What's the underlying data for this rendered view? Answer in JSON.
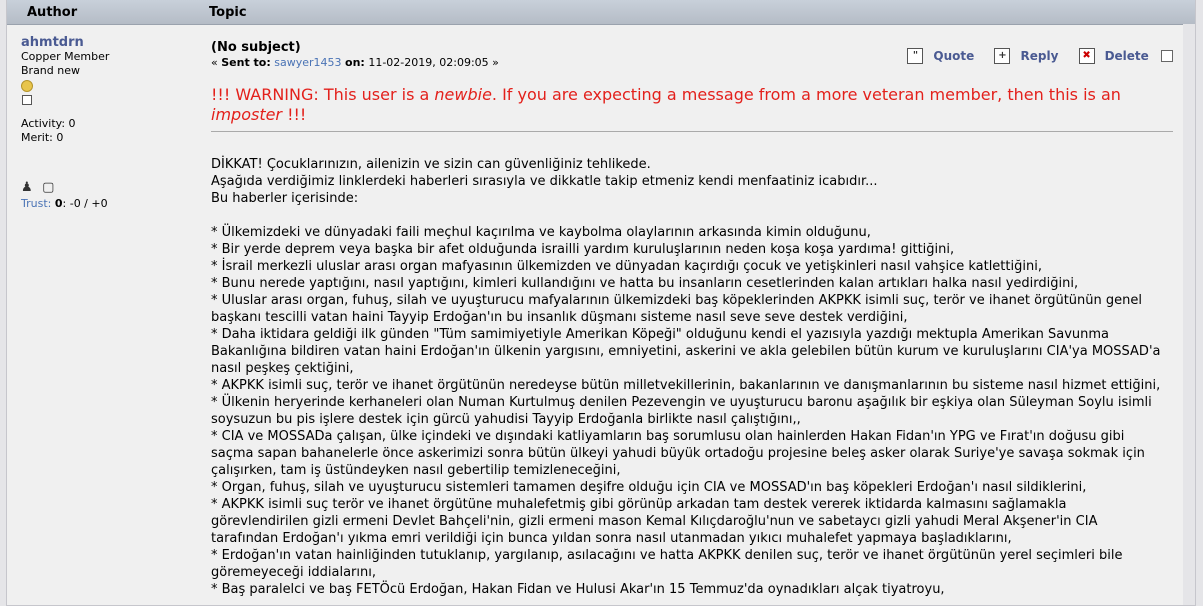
{
  "header": {
    "author": "Author",
    "topic": "Topic"
  },
  "user": {
    "name": "ahmtdrn",
    "rank": "Copper Member",
    "status": "Brand new",
    "activity": "Activity: 0",
    "merit": "Merit: 0",
    "trust_label": "Trust:",
    "trust_score": "0",
    "trust_rest": ": -0 / +0"
  },
  "post": {
    "subject": "(No subject)",
    "sent_prefix": "«",
    "sent_label": "Sent to:",
    "sent_to": "sawyer1453",
    "on_label": "on:",
    "date": "11-02-2019, 02:09:05",
    "sent_suffix": "»",
    "actions": {
      "quote": "Quote",
      "reply": "Reply",
      "delete": "Delete"
    },
    "warning": {
      "a": "!!! WARNING: This user is a ",
      "b": "newbie",
      "c": ". If you are expecting a message from a more veteran member, then this is an ",
      "d": "imposter",
      "e": " !!!"
    },
    "lines": [
      "DİKKAT! Çocuklarınızın, ailenizin ve sizin can güvenliğiniz tehlikede.",
      "Aşağıda verdiğimiz linklerdeki haberleri sırasıyla ve dikkatle takip etmeniz kendi menfaatiniz icabıdır...",
      "Bu haberler içerisinde:",
      "",
      "* Ülkemizdeki ve dünyadaki faili meçhul kaçırılma ve kaybolma olaylarının arkasında kimin olduğunu,",
      "* Bir yerde deprem veya başka bir afet olduğunda israilli yardım kuruluşlarının neden koşa koşa yardıma! gittiğini,",
      "* İsrail merkezli uluslar arası organ mafyasının ülkemizden ve dünyadan kaçırdığı çocuk ve yetişkinleri nasıl vahşice katlettiğini,",
      "* Bunu nerede yaptığını, nasıl yaptığını, kimleri kullandığını ve hatta bu insanların cesetlerinden kalan artıkları halka nasıl yedirdiğini,",
      "* Uluslar arası organ, fuhuş, silah ve uyuşturucu mafyalarının ülkemizdeki baş köpeklerinden AKPKK isimli suç, terör ve ihanet örgütünün genel başkanı tescilli vatan haini Tayyip Erdoğan'ın bu insanlık düşmanı sisteme nasıl seve seve destek verdiğini,",
      "* Daha iktidara geldiği ilk günden \"Tüm samimiyetiyle Amerikan Köpeği\" olduğunu kendi el yazısıyla yazdığı mektupla Amerikan Savunma Bakanlığına bildiren vatan haini Erdoğan'ın ülkenin yargısını, emniyetini, askerini ve akla gelebilen bütün kurum ve kuruluşlarını CIA'ya MOSSAD'a nasıl peşkeş çektiğini,",
      "* AKPKK isimli suç, terör ve ihanet örgütünün neredeyse bütün milletvekillerinin, bakanlarının ve danışmanlarının bu sisteme nasıl hizmet ettiğini,",
      "* Ülkenin heryerinde kerhaneleri olan Numan Kurtulmuş denilen Pezevengin ve uyuşturucu baronu aşağılık bir eşkiya olan Süleyman Soylu isimli soysuzun bu pis işlere destek için gürcü yahudisi Tayyip Erdoğanla birlikte nasıl çalıştığını,,",
      "* CIA ve MOSSADa çalışan, ülke içindeki ve dışındaki katliyamların baş sorumlusu olan hainlerden Hakan Fidan'ın YPG ve Fırat'ın doğusu gibi saçma sapan bahanelerle önce askerimizi sonra bütün ülkeyi yahudi büyük ortadoğu projesine beleş asker olarak Suriye'ye savaşa sokmak için çalışırken, tam iş üstündeyken nasıl gebertilip temizleneceğini,",
      "* Organ, fuhuş, silah ve uyuşturucu sistemleri tamamen deşifre olduğu için CIA ve MOSSAD'ın baş köpekleri Erdoğan'ı nasıl sildiklerini,",
      "* AKPKK isimli suç terör ve ihanet örgütüne muhalefetmiş gibi görünüp arkadan tam destek vererek iktidarda kalmasını sağlamakla görevlendirilen gizli ermeni Devlet Bahçeli'nin, gizli ermeni mason Kemal Kılıçdaroğlu'nun ve sabetaycı gizli yahudi Meral Akşener'in CIA tarafından Erdoğan'ı yıkma emri verildiği için bunca yıldan sonra nasıl utanmadan yıkıcı muhalefet yapmaya başladıklarını,",
      "* Erdoğan'ın vatan hainliğinden tutuklanıp, yargılanıp, asılacağını ve hatta AKPKK denilen suç, terör ve ihanet örgütünün yerel seçimleri bile göremeyeceği iddialarını,",
      "* Baş paralelci ve baş FETÖcü Erdoğan, Hakan Fidan ve Hulusi Akar'ın 15 Temmuz'da oynadıkları alçak tiyatroyu,"
    ]
  }
}
